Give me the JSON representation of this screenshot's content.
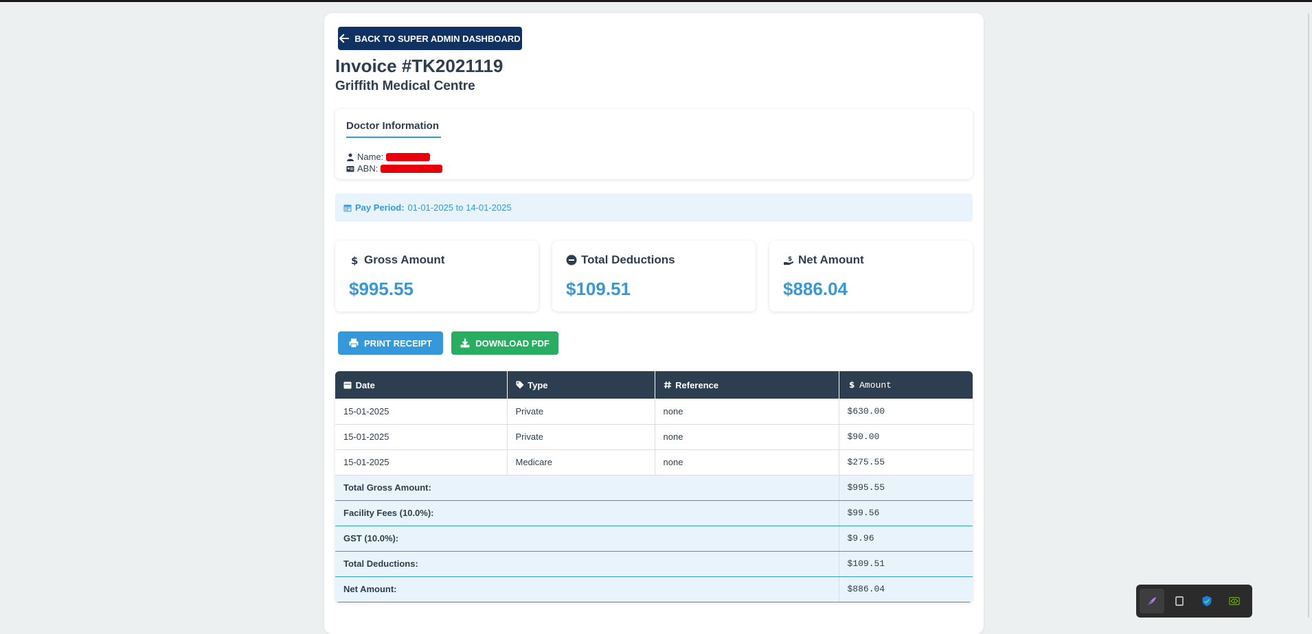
{
  "header": {
    "back_label": "BACK TO SUPER ADMIN DASHBOARD",
    "invoice_title": "Invoice #TK2021119",
    "clinic_name": "Griffith Medical Centre"
  },
  "doctor": {
    "section_title": "Doctor Information",
    "name_label": "Name:",
    "abn_label": "ABN:"
  },
  "pay_period": {
    "label": "Pay Period:",
    "value": "01-01-2025 to 14-01-2025"
  },
  "stats": [
    {
      "title": "Gross Amount",
      "value": "$995.55",
      "icon": "dollar-icon"
    },
    {
      "title": "Total Deductions",
      "value": "$109.51",
      "icon": "minus-circle-icon"
    },
    {
      "title": "Net Amount",
      "value": "$886.04",
      "icon": "hand-holding-dollar-icon"
    }
  ],
  "actions": {
    "print_label": "PRINT RECEIPT",
    "pdf_label": "DOWNLOAD PDF"
  },
  "table": {
    "headers": {
      "date": "Date",
      "type": "Type",
      "reference": "Reference",
      "amount": "Amount"
    },
    "rows": [
      {
        "date": "15-01-2025",
        "type": "Private",
        "reference": "none",
        "amount": "$630.00"
      },
      {
        "date": "15-01-2025",
        "type": "Private",
        "reference": "none",
        "amount": "$90.00"
      },
      {
        "date": "15-01-2025",
        "type": "Medicare",
        "reference": "none",
        "amount": "$275.55"
      }
    ],
    "summary": [
      {
        "label": "Total Gross Amount:",
        "value": "$995.55"
      },
      {
        "label": "Facility Fees (10.0%):",
        "value": "$99.56"
      },
      {
        "label": "GST (10.0%):",
        "value": "$9.96"
      },
      {
        "label": "Total Deductions:",
        "value": "$109.51"
      },
      {
        "label": "Net Amount:",
        "value": "$886.04"
      }
    ]
  },
  "colors": {
    "navy": "#0f3263",
    "accent": "#3498db",
    "success": "#27ae60",
    "header_dark": "#2c3e50"
  }
}
